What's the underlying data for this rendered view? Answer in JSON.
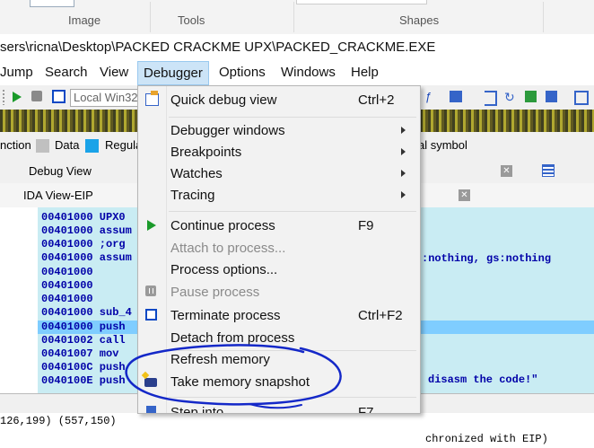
{
  "ribbon": {
    "groups": [
      "Image",
      "Tools",
      "Shapes"
    ]
  },
  "title": "sers\\ricna\\Desktop\\PACKED CRACKME UPX\\PACKED_CRACKME.EXE",
  "menubar": [
    "Jump",
    "Search",
    "View",
    "Debugger",
    "Options",
    "Windows",
    "Help"
  ],
  "toolbar": {
    "debugger_select": "Local Win32"
  },
  "legend": {
    "items": [
      "nction",
      "Data",
      "Regula",
      "al symbol"
    ],
    "colors": {
      "data": "#c0c0c0",
      "regular": "#1aa3e8"
    }
  },
  "tabs": {
    "debug_view": "Debug View",
    "ida_view": "IDA View-EIP"
  },
  "code": {
    "lines": [
      "00401000 UPX0",
      "00401000 assum",
      "00401000 ;org",
      "00401000 assum",
      "00401000",
      "00401000",
      "00401000",
      "00401000 sub_4",
      "00401000 push",
      "00401002 call",
      "00401007 mov",
      "0040100C push",
      "0040100E push"
    ],
    "right_text_1": ":nothing, gs:nothing",
    "right_text_2": "disasm the code!\""
  },
  "status": "126,199) (557,150)",
  "status_right": "chronized with EIP)",
  "dropdown": {
    "items": [
      {
        "label": "Quick debug view",
        "shortcut": "Ctrl+2",
        "icon": "quick-debug-icon"
      },
      {
        "label": "Debugger windows",
        "submenu": true
      },
      {
        "label": "Breakpoints",
        "submenu": true
      },
      {
        "label": "Watches",
        "submenu": true
      },
      {
        "label": "Tracing",
        "submenu": true
      },
      {
        "label": "Continue process",
        "shortcut": "F9",
        "icon": "play-icon"
      },
      {
        "label": "Attach to process...",
        "disabled": true
      },
      {
        "label": "Process options..."
      },
      {
        "label": "Pause process",
        "disabled": true,
        "icon": "pause-icon"
      },
      {
        "label": "Terminate process",
        "shortcut": "Ctrl+F2",
        "icon": "stop-icon"
      },
      {
        "label": "Detach from process"
      },
      {
        "label": "Refresh memory"
      },
      {
        "label": "Take memory snapshot",
        "icon": "snapshot-icon"
      },
      {
        "label": "Step into",
        "shortcut": "F7"
      }
    ]
  },
  "annotation": {
    "color": "#1428c8"
  }
}
